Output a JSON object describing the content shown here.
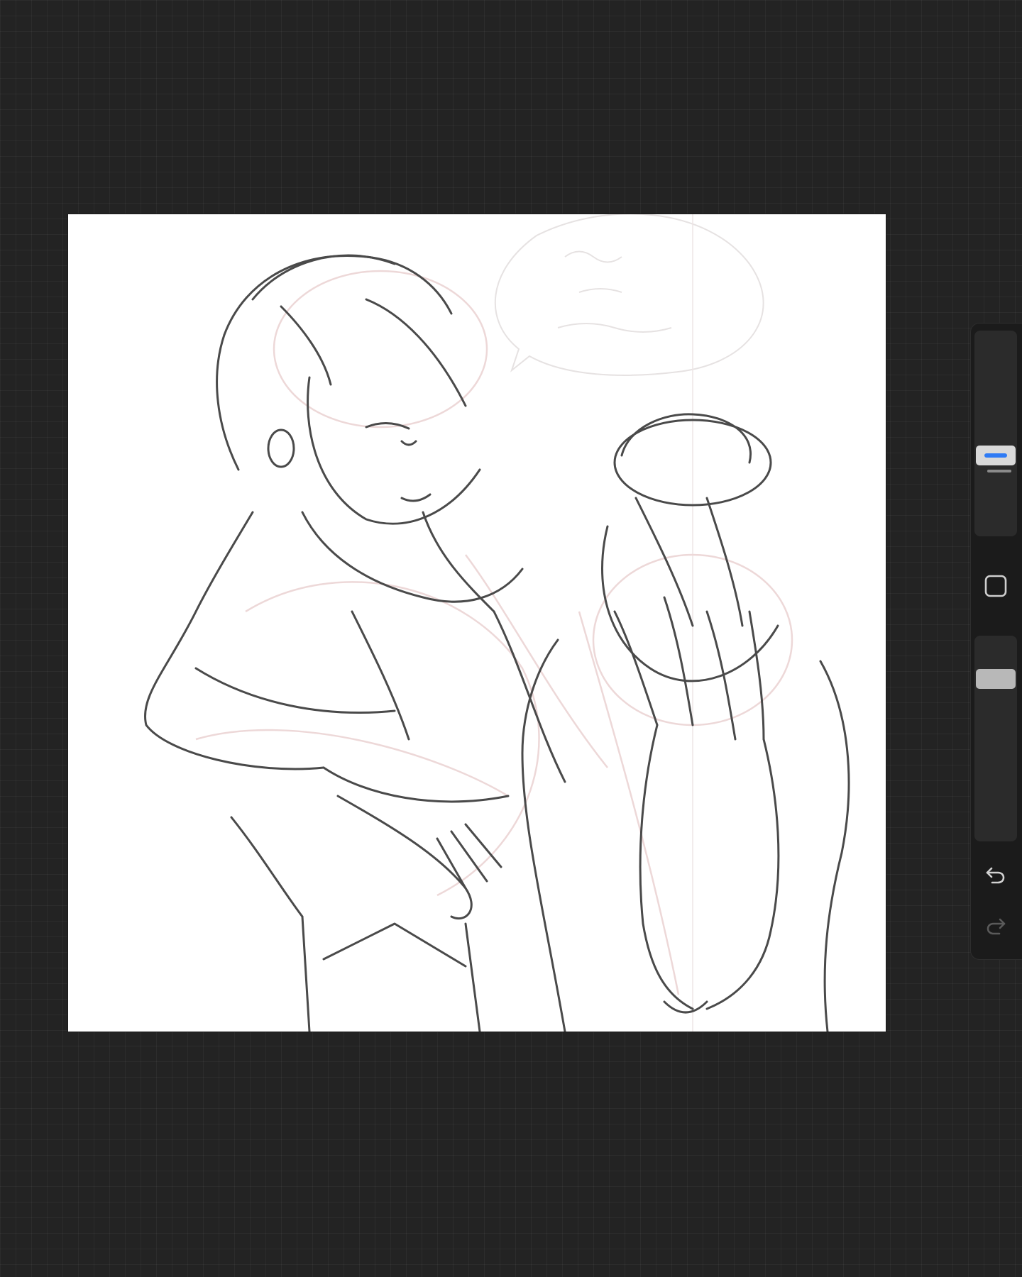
{
  "app": {
    "background_color": "#232323",
    "accent_color": "#2f7bf5"
  },
  "canvas": {
    "content": "sketch-artwork"
  },
  "sidebar": {
    "brush_size_slider": {
      "value": 0.38
    },
    "modify_button": {
      "icon": "square-icon"
    },
    "opacity_slider": {
      "value": 0.82
    },
    "undo_button": {
      "icon": "undo-icon"
    },
    "redo_button": {
      "icon": "redo-icon",
      "enabled": false
    }
  }
}
